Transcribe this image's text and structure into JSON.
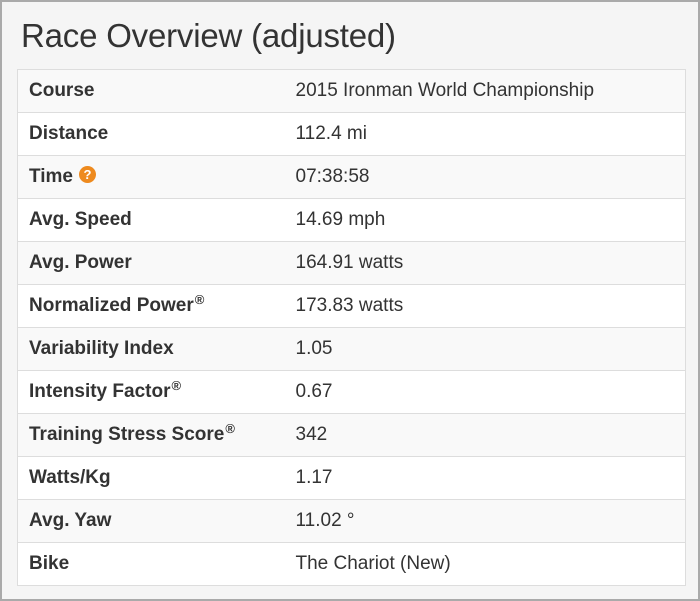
{
  "title": "Race Overview (adjusted)",
  "colors": {
    "help_icon": "#ee8a1e",
    "border": "#dddddd",
    "text": "#333333"
  },
  "rows": [
    {
      "label": "Course",
      "registered": "",
      "value": "2015 Ironman World Championship"
    },
    {
      "label": "Distance",
      "registered": "",
      "value": "112.4 mi"
    },
    {
      "label": "Time",
      "registered": "",
      "value": "07:38:58",
      "help_icon": "?"
    },
    {
      "label": "Avg. Speed",
      "registered": "",
      "value": "14.69 mph"
    },
    {
      "label": "Avg. Power",
      "registered": "",
      "value": "164.91 watts"
    },
    {
      "label": "Normalized Power",
      "registered": "®",
      "value": "173.83 watts"
    },
    {
      "label": "Variability Index",
      "registered": "",
      "value": "1.05"
    },
    {
      "label": "Intensity Factor",
      "registered": "®",
      "value": "0.67"
    },
    {
      "label": "Training Stress Score",
      "registered": "®",
      "value": "342"
    },
    {
      "label": "Watts/Kg",
      "registered": "",
      "value": "1.17"
    },
    {
      "label": "Avg. Yaw",
      "registered": "",
      "value": "11.02 °"
    },
    {
      "label": "Bike",
      "registered": "",
      "value": "The Chariot (New)"
    }
  ]
}
